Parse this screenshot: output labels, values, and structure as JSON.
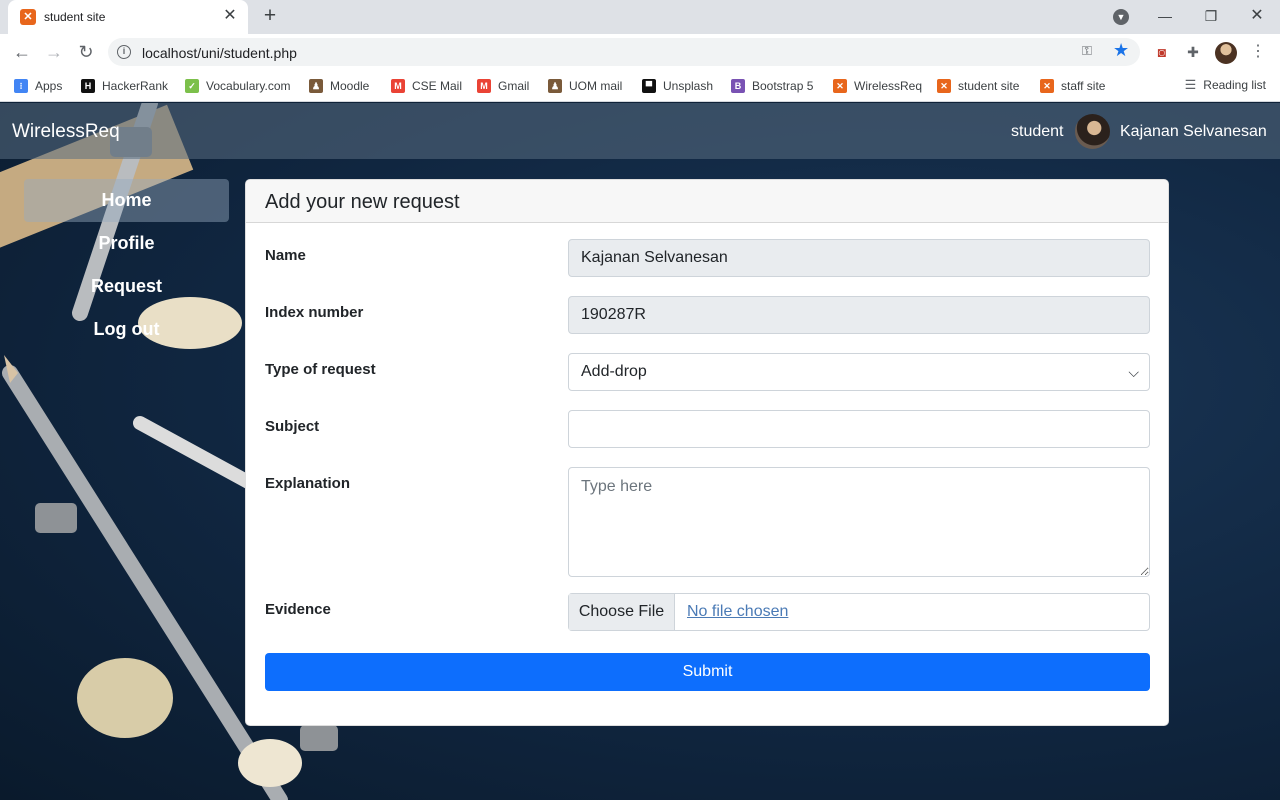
{
  "browser": {
    "tab_title": "student site",
    "tab_close": "✕",
    "new_tab": "+",
    "url": "localhost/uni/student.php",
    "bookmarks": [
      {
        "label": "Apps",
        "icon": "apps-grid-icon"
      },
      {
        "label": "HackerRank",
        "icon": "hackerrank-icon"
      },
      {
        "label": "Vocabulary.com",
        "icon": "vocabulary-icon"
      },
      {
        "label": "Moodle",
        "icon": "moodle-icon"
      },
      {
        "label": "CSE Mail",
        "icon": "gmail-icon"
      },
      {
        "label": "Gmail",
        "icon": "gmail-icon"
      },
      {
        "label": "UOM mail",
        "icon": "uom-icon"
      },
      {
        "label": "Unsplash",
        "icon": "unsplash-icon"
      },
      {
        "label": "Bootstrap 5",
        "icon": "bootstrap-icon"
      },
      {
        "label": "WirelessReq",
        "icon": "xampp-icon"
      },
      {
        "label": "student site",
        "icon": "xampp-icon"
      },
      {
        "label": "staff site",
        "icon": "xampp-icon"
      }
    ],
    "reading_list": "Reading list"
  },
  "navbar": {
    "brand": "WirelessReq",
    "role": "student",
    "user_name": "Kajanan Selvanesan"
  },
  "sidebar": {
    "items": [
      {
        "label": "Home",
        "active": true
      },
      {
        "label": "Profile",
        "active": false
      },
      {
        "label": "Request",
        "active": false
      },
      {
        "label": "Log out",
        "active": false
      }
    ]
  },
  "form": {
    "title": "Add your new request",
    "name_label": "Name",
    "name_value": "Kajanan Selvanesan",
    "index_label": "Index number",
    "index_value": "190287R",
    "type_label": "Type of request",
    "type_value": "Add-drop",
    "subject_label": "Subject",
    "subject_value": "",
    "explanation_label": "Explanation",
    "explanation_placeholder": "Type here",
    "evidence_label": "Evidence",
    "file_button": "Choose File",
    "file_status": "No file chosen",
    "submit_label": "Submit"
  },
  "colors": {
    "primary": "#0d6efd",
    "navbar": "rgba(90,110,130,0.55)",
    "xampp_orange": "#e8661c"
  }
}
